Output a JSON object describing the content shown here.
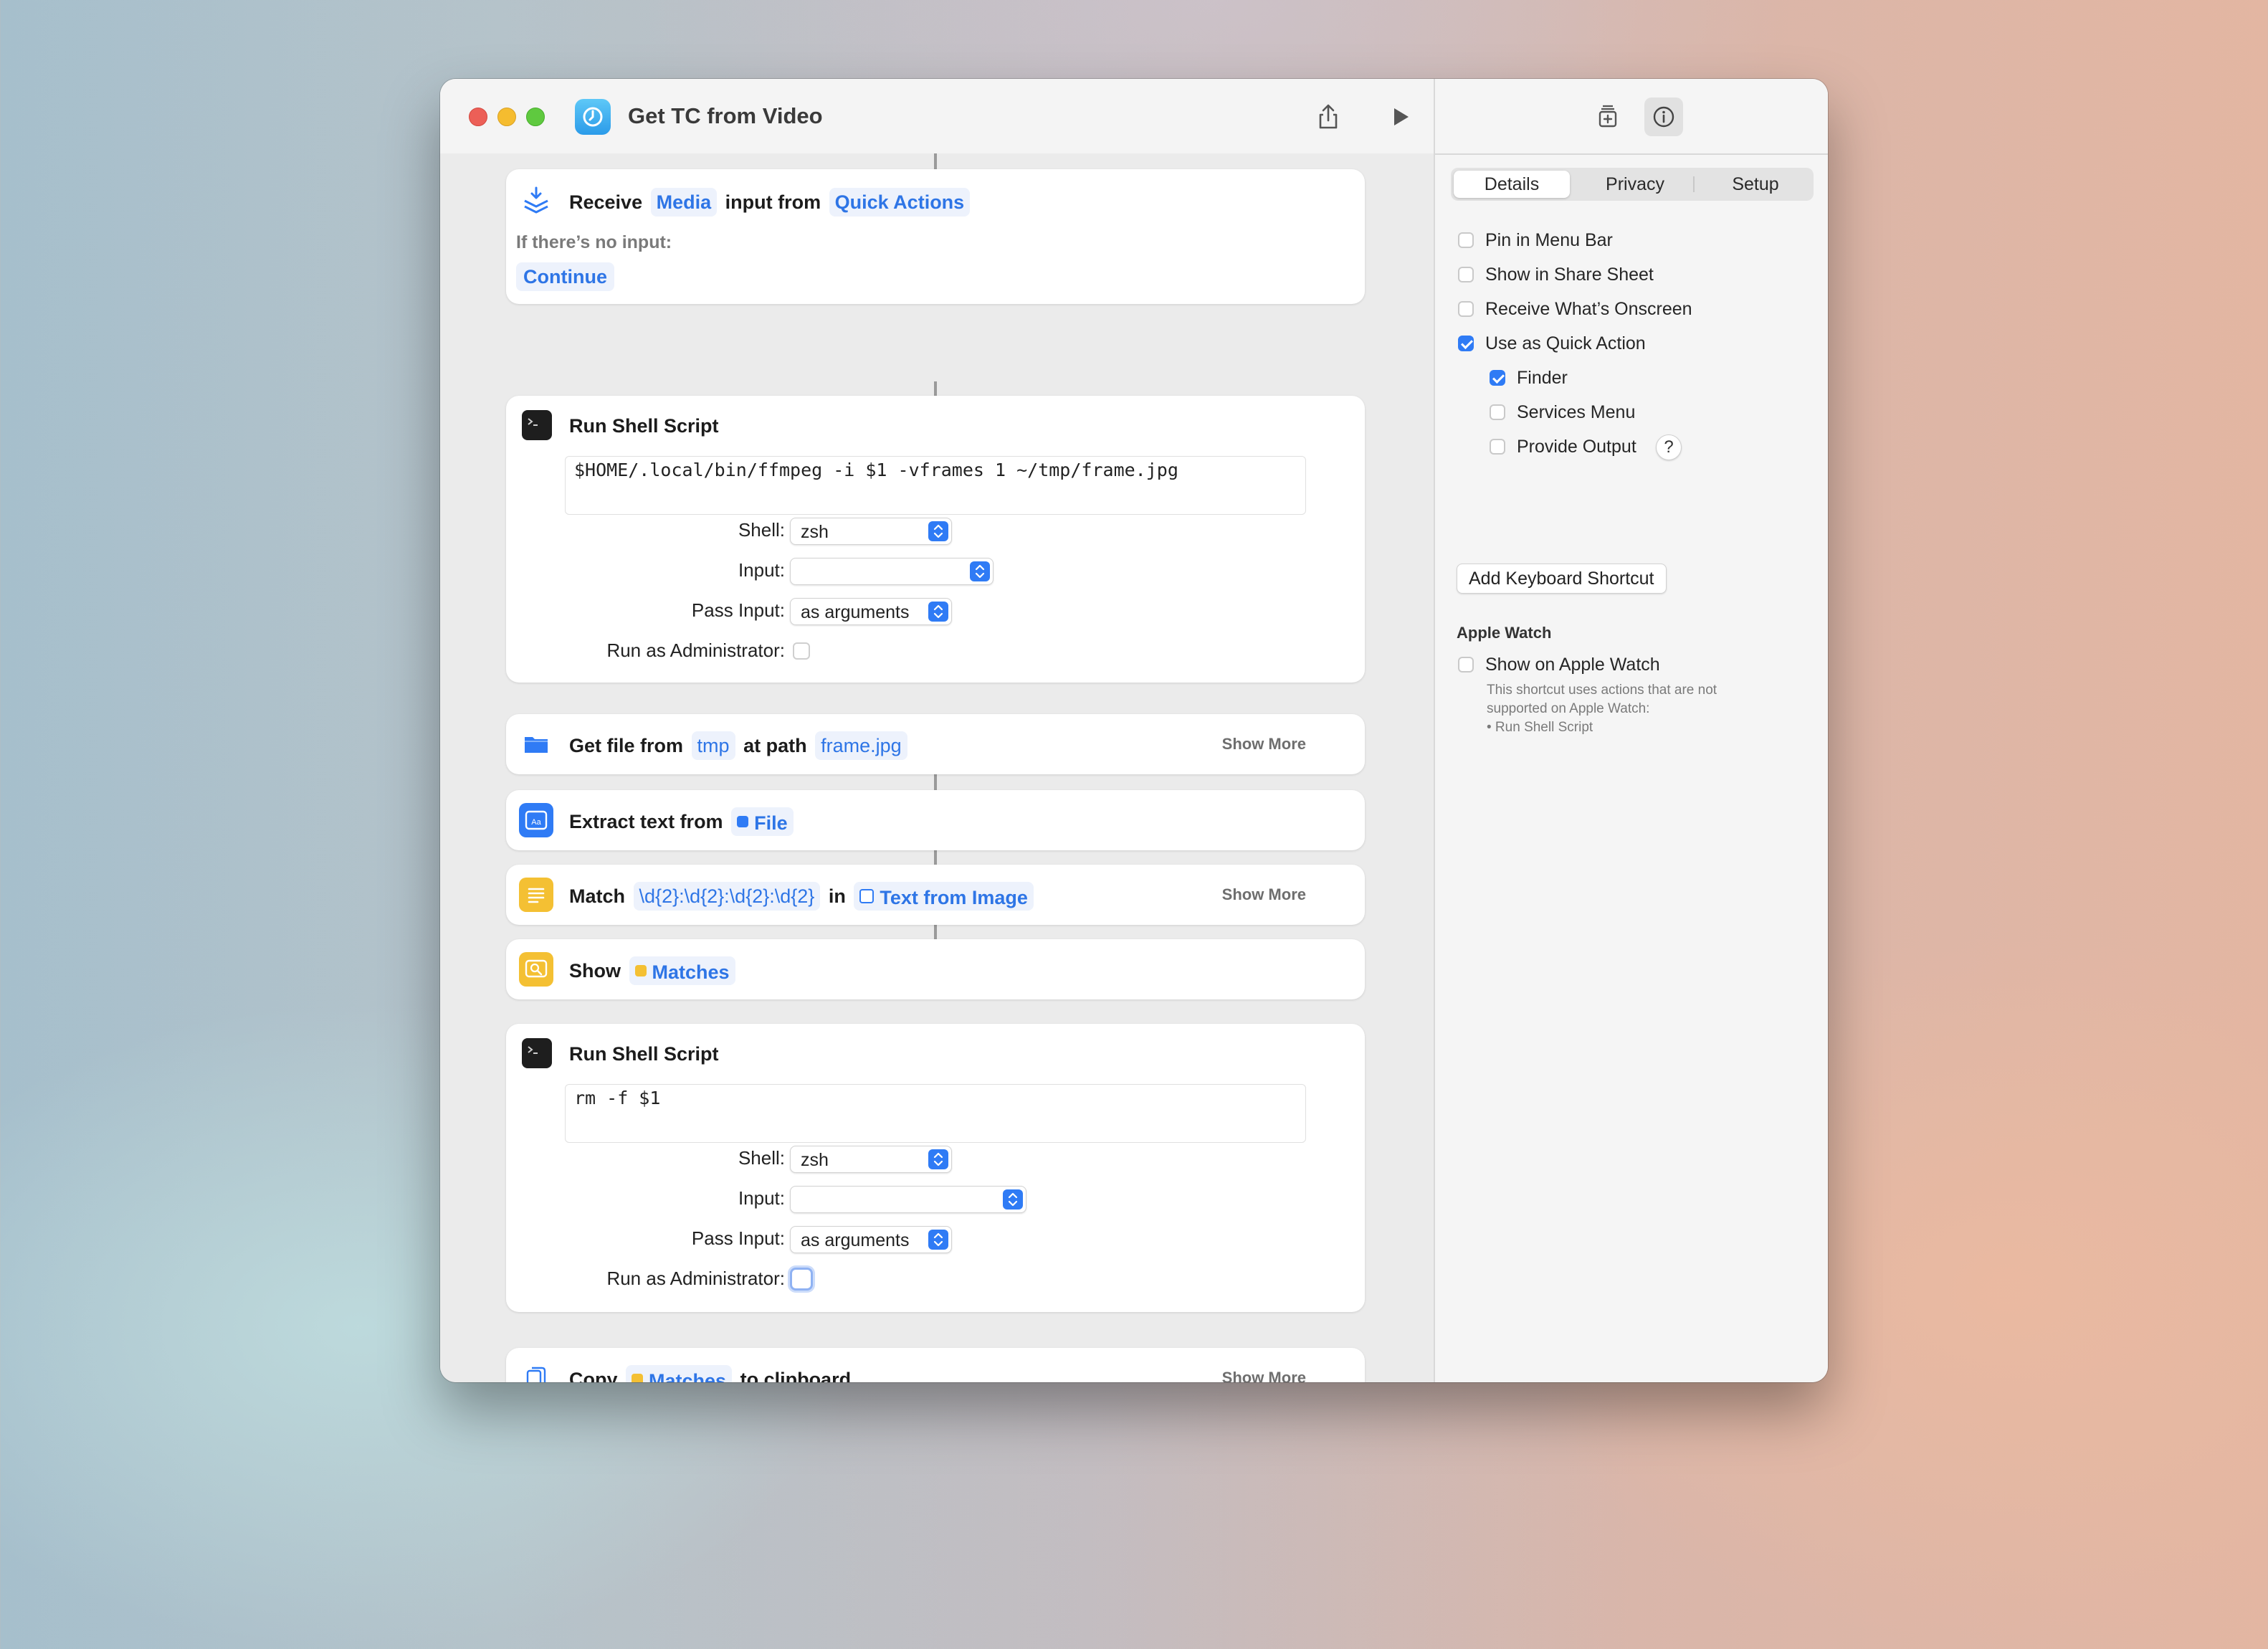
{
  "window": {
    "title": "Get TC from Video"
  },
  "toolbar": {
    "share_icon": "share-icon",
    "run_icon": "play-icon",
    "library_icon": "action-library-icon",
    "info_icon": "info-icon"
  },
  "sidebar": {
    "tabs": [
      "Details",
      "Privacy",
      "Setup"
    ],
    "active_tab": "Details",
    "options": [
      {
        "label": "Pin in Menu Bar",
        "checked": false
      },
      {
        "label": "Show in Share Sheet",
        "checked": false
      },
      {
        "label": "Receive What’s Onscreen",
        "checked": false
      },
      {
        "label": "Use as Quick Action",
        "checked": true
      },
      {
        "label": "Finder",
        "checked": true
      },
      {
        "label": "Services Menu",
        "checked": false
      },
      {
        "label": "Provide Output",
        "checked": false
      }
    ],
    "help_label": "?",
    "keyboard_shortcut_button": "Add Keyboard Shortcut",
    "apple_watch": {
      "heading": "Apple Watch",
      "option_label": "Show on Apple Watch",
      "checked": false,
      "note_lines": [
        "This shortcut uses actions that are not",
        "supported on Apple Watch:",
        "• Run Shell Script"
      ]
    }
  },
  "actions": {
    "receive": {
      "word1": "Receive",
      "token1": "Media",
      "word2": "input from",
      "token2": "Quick Actions",
      "no_input_label": "If there’s no input:",
      "no_input_value": "Continue"
    },
    "shell1": {
      "title": "Run Shell Script",
      "script": "$HOME/.local/bin/ffmpeg -i $1 -vframes 1 ~/tmp/frame.jpg",
      "shell_label": "Shell:",
      "shell_value": "zsh",
      "input_label": "Input:",
      "input_value": "",
      "pass_label": "Pass Input:",
      "pass_value": "as arguments",
      "admin_label": "Run as Administrator:",
      "admin_checked": false
    },
    "getfile": {
      "word1": "Get file from",
      "token1": "tmp",
      "word2": "at path",
      "token2": "frame.jpg",
      "show_more": "Show More"
    },
    "extract": {
      "word1": "Extract text from",
      "token1": "File"
    },
    "match": {
      "word1": "Match",
      "token1": "\\d{2}:\\d{2}:\\d{2}:\\d{2}",
      "word2": "in",
      "token2": "Text from Image",
      "show_more": "Show More"
    },
    "show": {
      "word1": "Show",
      "token1": "Matches"
    },
    "shell2": {
      "title": "Run Shell Script",
      "script": "rm -f $1",
      "shell_label": "Shell:",
      "shell_value": "zsh",
      "input_label": "Input:",
      "input_value": "",
      "pass_label": "Pass Input:",
      "pass_value": "as arguments",
      "admin_label": "Run as Administrator:",
      "admin_checked": false
    },
    "copy": {
      "word1": "Copy",
      "token1": "Matches",
      "word2": "to clipboard",
      "show_more": "Show More"
    }
  },
  "colors": {
    "accent": "#2f7bf5",
    "token_text": "#2e75e6",
    "token_bg": "#edf2fc"
  }
}
